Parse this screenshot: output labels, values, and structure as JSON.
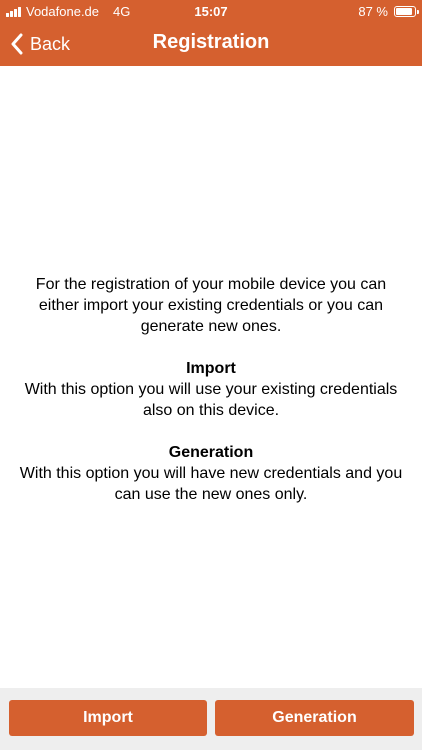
{
  "status_bar": {
    "carrier": "Vodafone.de",
    "network": "4G",
    "time": "15:07",
    "battery_text": "87 %",
    "battery_level": 0.87
  },
  "nav": {
    "back_label": "Back",
    "title": "Registration"
  },
  "content": {
    "intro": "For the registration of your mobile device you can either import your existing credentials or you can generate new ones.",
    "import_heading": "Import",
    "import_text": "With this option you will use your existing credentials also on this device.",
    "generation_heading": "Generation",
    "generation_text": "With this option you will have new credentials and you can use the new ones only."
  },
  "footer": {
    "import_button": "Import",
    "generation_button": "Generation"
  },
  "colors": {
    "accent": "#d5602f",
    "footer_background": "#eeeeee"
  }
}
